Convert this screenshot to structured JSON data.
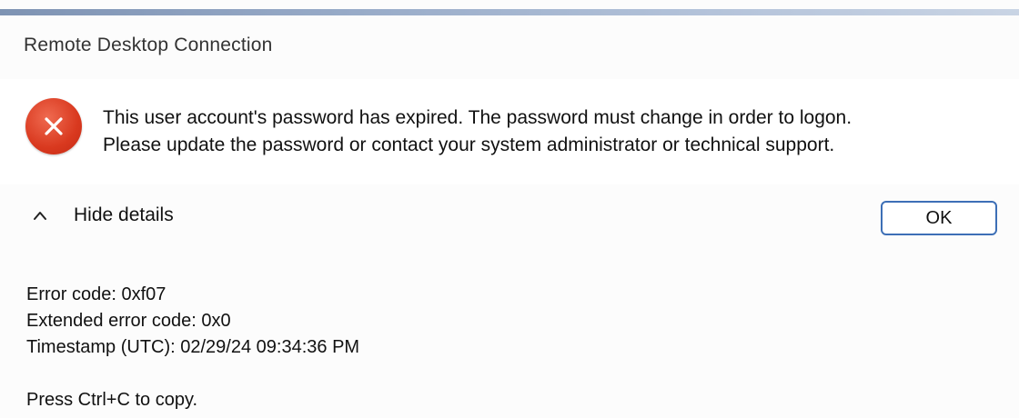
{
  "window": {
    "title": "Remote Desktop Connection"
  },
  "message": {
    "icon": "error-icon",
    "icon_color": "#d9391f",
    "line1": "This user account's password has expired. The password must change in order to logon.",
    "line2": "Please update the password or contact your system administrator or technical support."
  },
  "details_toggle": {
    "icon": "chevron-up-icon",
    "label": "Hide details"
  },
  "ok_button": {
    "label": "OK",
    "border_color": "#3d6fb6"
  },
  "details": {
    "error_code": "Error code: 0xf07",
    "extended_error_code": "Extended error code: 0x0",
    "timestamp": "Timestamp (UTC): 02/29/24 09:34:36 PM",
    "copy_hint": "Press Ctrl+C to copy."
  }
}
